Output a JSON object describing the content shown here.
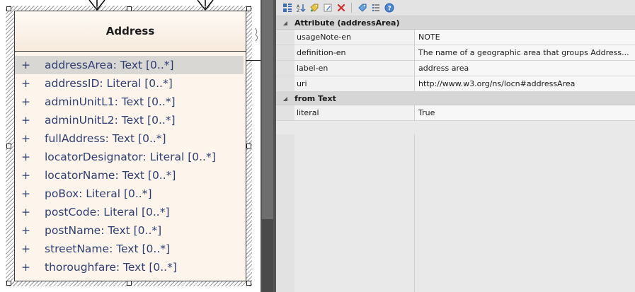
{
  "diagram": {
    "class_name": "Address",
    "attributes": [
      {
        "visibility": "+",
        "text": "addressArea: Text [0..*]"
      },
      {
        "visibility": "+",
        "text": "addressID: Literal [0..*]"
      },
      {
        "visibility": "+",
        "text": "adminUnitL1: Text [0..*]"
      },
      {
        "visibility": "+",
        "text": "adminUnitL2: Text [0..*]"
      },
      {
        "visibility": "+",
        "text": "fullAddress: Text [0..*]"
      },
      {
        "visibility": "+",
        "text": "locatorDesignator: Literal [0..*]"
      },
      {
        "visibility": "+",
        "text": "locatorName: Text [0..*]"
      },
      {
        "visibility": "+",
        "text": "poBox: Literal [0..*]"
      },
      {
        "visibility": "+",
        "text": "postCode: Literal [0..*]"
      },
      {
        "visibility": "+",
        "text": "postName: Text [0..*]"
      },
      {
        "visibility": "+",
        "text": "streetName: Text [0..*]"
      },
      {
        "visibility": "+",
        "text": "thoroughfare: Text [0..*]"
      }
    ],
    "selected_attribute": "addressArea: Text [0..*]"
  },
  "properties": {
    "toolbar_icons": [
      "categorize-icon",
      "sort-alpha-icon",
      "new-tag-icon",
      "edit-icon",
      "delete-icon",
      "tag-icon",
      "list-icon",
      "help-icon"
    ],
    "categories": [
      {
        "title": "Attribute (addressArea)",
        "rows": [
          {
            "name": "usageNote-en",
            "value": "NOTE"
          },
          {
            "name": "definition-en",
            "value": "The name of a geographic area that groups Address..."
          },
          {
            "name": "label-en",
            "value": "address area"
          },
          {
            "name": "uri",
            "value": "http://www.w3.org/ns/locn#addressArea"
          }
        ]
      },
      {
        "title": "from Text",
        "rows": [
          {
            "name": "literal",
            "value": "True"
          }
        ]
      }
    ]
  }
}
